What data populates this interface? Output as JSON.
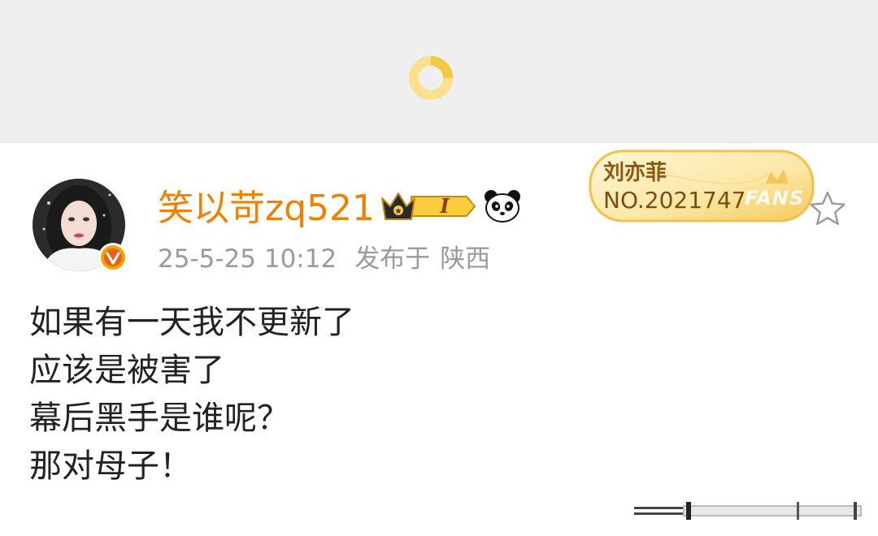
{
  "post": {
    "username": "笑以苛zq521",
    "timestamp": "25-5-25 10:12",
    "published_in_label": "发布于",
    "location": "陕西",
    "level_badge": "I",
    "fan_card": {
      "idol_name": "刘亦菲",
      "number": "NO.2021747",
      "tag": "FANS"
    },
    "content_lines": [
      "如果有一天我不更新了",
      "应该是被害了",
      "幕后黑手是谁呢？",
      "那对母子！"
    ]
  },
  "icons": {
    "loader": "loading-spinner-icon",
    "verified": "verified-v-icon",
    "crown": "crown-icon",
    "panda": "panda-icon",
    "star": "star-outline-icon"
  },
  "colors": {
    "username": "#f08100",
    "meta": "#9a9a9a",
    "loader": "#fbd86a",
    "verified": "#f5a500",
    "card_gold": "#f8d680"
  }
}
